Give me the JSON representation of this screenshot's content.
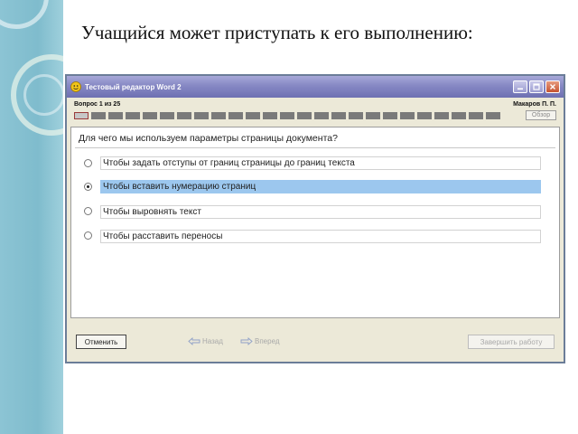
{
  "slide": {
    "title": "Учащийся может приступать к его выполнению:"
  },
  "window": {
    "title": "Тестовый редактор Word 2",
    "minimize_icon": "minimize-icon",
    "maximize_icon": "maximize-icon",
    "close_icon": "close-icon"
  },
  "header": {
    "question_counter": "Вопрос 1 из 25",
    "user_name": "Макаров П. П.",
    "review_label": "Обзор"
  },
  "progress": {
    "total": 25,
    "current": 1
  },
  "question": {
    "text": "Для чего мы используем параметры страницы документа?",
    "answers": [
      {
        "label": "Чтобы задать отступы от границ страницы до границ текста",
        "selected": false
      },
      {
        "label": "Чтобы вставить нумерацию страниц",
        "selected": true
      },
      {
        "label": "Чтобы выровнять текст",
        "selected": false
      },
      {
        "label": "Чтобы расставить переносы",
        "selected": false
      }
    ]
  },
  "footer": {
    "cancel_label": "Отменить",
    "back_label": "Назад",
    "forward_label": "Вперед",
    "finish_label": "Завершить работу"
  },
  "colors": {
    "titlebar": "#8688c4",
    "selected_answer": "#9cc7ee",
    "progress_done": "#7a7a7a",
    "accent_strip": "#8cc4d4"
  }
}
